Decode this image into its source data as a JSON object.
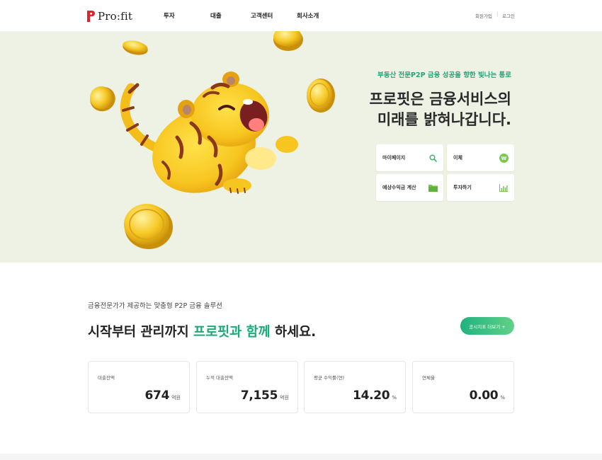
{
  "header": {
    "logo_text": "Pro:fit",
    "nav": [
      "투자",
      "대출",
      "고객센터",
      "회사소개"
    ],
    "util": {
      "signup": "회원가입",
      "separator": "|",
      "login": "로그인"
    }
  },
  "hero": {
    "subtitle": "부동산 전문P2P 금융 성공을 향한 빛나는 통로",
    "title_line1": "프로핏은 금융서비스의",
    "title_line2": "미래를 밝혀나갑니다.",
    "quick_buttons": [
      {
        "label": "마이페이지",
        "icon": "search-icon"
      },
      {
        "label": "이체",
        "icon": "won-icon"
      },
      {
        "label": "예상수익금 계산",
        "icon": "folder-icon"
      },
      {
        "label": "투자하기",
        "icon": "bar-chart-icon"
      }
    ]
  },
  "solutions": {
    "subtitle": "금융전문가가 제공하는 맞춤형 P2P 금융 솔루션",
    "title_pre": "시작부터 관리까지 ",
    "title_accent": "프로핏과 함께",
    "title_post": " 하세요.",
    "more_button": "공시지표 더보기 +",
    "stats": [
      {
        "label": "대출잔액",
        "value": "674",
        "unit": "억원"
      },
      {
        "label": "누적 대출잔액",
        "value": "7,155",
        "unit": "억원"
      },
      {
        "label": "평균 수익률(연)",
        "value": "14.20",
        "unit": "%"
      },
      {
        "label": "연체율",
        "value": "0.00",
        "unit": "%"
      }
    ]
  },
  "colors": {
    "brand_red": "#e0242c",
    "accent_green": "#1eaa78",
    "hero_bg": "#eef2e5"
  }
}
